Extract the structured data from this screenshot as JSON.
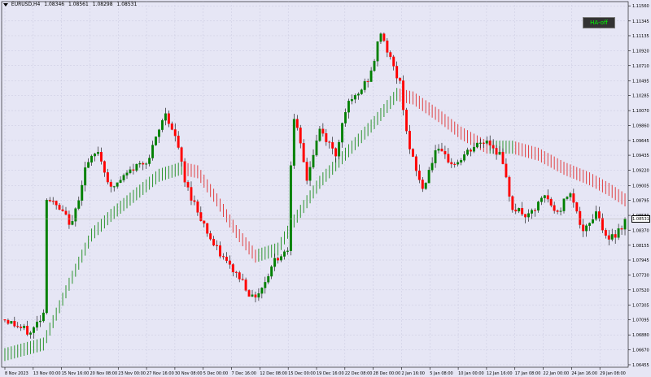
{
  "window": {
    "symbol": "EURUSD,H4",
    "ohlc": [
      "1.08346",
      "1.08561",
      "1.08298",
      "1.08531"
    ]
  },
  "ha_button": {
    "label": "HA-off"
  },
  "current_price": "1.08531",
  "colors": {
    "background": "#e6e6f5",
    "grid": "#c8c8de",
    "bull": "#008000",
    "bear": "#ff0000",
    "ha_bull": "#1a8c1a",
    "ha_bear": "#e03030",
    "candle_wick": "#000000"
  },
  "chart_data": {
    "type": "candlestick",
    "y_ticks": [
      "1.11560",
      "1.11345",
      "1.11135",
      "1.10920",
      "1.10710",
      "1.10495",
      "1.10285",
      "1.10070",
      "1.09860",
      "1.09645",
      "1.09435",
      "1.09220",
      "1.09005",
      "1.08795",
      "1.08580",
      "1.08370",
      "1.08155",
      "1.07945",
      "1.07730",
      "1.07520",
      "1.07305",
      "1.07095",
      "1.06880",
      "1.06670",
      "1.06455"
    ],
    "x_ticks": [
      "8 Nov 2023",
      "13 Nov 00:00",
      "15 Nov 16:00",
      "20 Nov 08:00",
      "23 Nov 00:00",
      "27 Nov 16:00",
      "30 Nov 08:00",
      "5 Dec 00:00",
      "7 Dec 16:00",
      "12 Dec 08:00",
      "15 Dec 00:00",
      "19 Dec 16:00",
      "22 Dec 08:00",
      "28 Dec 00:00",
      "2 Jan 16:00",
      "5 Jan 08:00",
      "10 Jan 00:00",
      "12 Jan 16:00",
      "17 Jan 08:00",
      "22 Jan 00:00",
      "24 Jan 16:00",
      "29 Jan 08:00"
    ],
    "ylim": [
      1.0642,
      1.1162
    ],
    "anchors": [
      [
        0,
        1.071
      ],
      [
        8,
        1.069
      ],
      [
        12,
        1.072
      ],
      [
        13,
        1.0885
      ],
      [
        18,
        1.086
      ],
      [
        21,
        1.0845
      ],
      [
        25,
        1.0925
      ],
      [
        29,
        1.095
      ],
      [
        33,
        1.0895
      ],
      [
        40,
        1.0925
      ],
      [
        45,
        1.094
      ],
      [
        50,
        1.1005
      ],
      [
        54,
        1.0955
      ],
      [
        56,
        1.0905
      ],
      [
        61,
        1.0855
      ],
      [
        65,
        1.0815
      ],
      [
        70,
        1.0785
      ],
      [
        74,
        1.0765
      ],
      [
        77,
        1.074
      ],
      [
        80,
        1.0755
      ],
      [
        84,
        1.0795
      ],
      [
        88,
        1.081
      ],
      [
        89,
        1.0935
      ],
      [
        90,
        1.1
      ],
      [
        94,
        1.091
      ],
      [
        98,
        1.098
      ],
      [
        103,
        1.0945
      ],
      [
        106,
        1.101
      ],
      [
        110,
        1.103
      ],
      [
        114,
        1.106
      ],
      [
        117,
        1.112
      ],
      [
        120,
        1.108
      ],
      [
        123,
        1.1045
      ],
      [
        126,
        1.095
      ],
      [
        130,
        1.0895
      ],
      [
        134,
        1.095
      ],
      [
        140,
        1.093
      ],
      [
        146,
        1.0955
      ],
      [
        150,
        1.0965
      ],
      [
        154,
        1.0945
      ],
      [
        158,
        1.087
      ],
      [
        163,
        1.0855
      ],
      [
        168,
        1.0885
      ],
      [
        172,
        1.086
      ],
      [
        176,
        1.0895
      ],
      [
        180,
        1.083
      ],
      [
        184,
        1.0865
      ],
      [
        188,
        1.082
      ],
      [
        193,
        1.085
      ]
    ],
    "ha_line": [
      [
        0,
        1.066
      ],
      [
        12,
        1.0675
      ],
      [
        20,
        1.076
      ],
      [
        27,
        1.083
      ],
      [
        33,
        1.0858
      ],
      [
        40,
        1.0885
      ],
      [
        48,
        1.0915
      ],
      [
        55,
        1.0925
      ],
      [
        60,
        1.092
      ],
      [
        66,
        1.088
      ],
      [
        72,
        1.0835
      ],
      [
        78,
        1.08
      ],
      [
        85,
        1.081
      ],
      [
        90,
        1.085
      ],
      [
        98,
        1.0905
      ],
      [
        106,
        1.0945
      ],
      [
        115,
        1.099
      ],
      [
        122,
        1.103
      ],
      [
        127,
        1.1025
      ],
      [
        135,
        1.1
      ],
      [
        142,
        1.0975
      ],
      [
        150,
        1.0955
      ],
      [
        158,
        1.0955
      ],
      [
        166,
        1.0945
      ],
      [
        174,
        1.0925
      ],
      [
        182,
        1.091
      ],
      [
        188,
        1.0895
      ],
      [
        193,
        1.088
      ]
    ],
    "bar_count": 194
  }
}
